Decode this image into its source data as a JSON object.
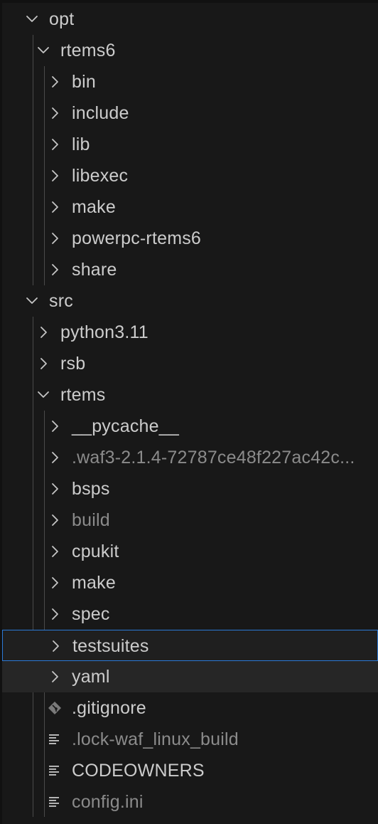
{
  "explorer": {
    "items": [
      {
        "label": "opt",
        "type": "folder",
        "expanded": true,
        "depth": 1
      },
      {
        "label": "rtems6",
        "type": "folder",
        "expanded": true,
        "depth": 2
      },
      {
        "label": "bin",
        "type": "folder",
        "expanded": false,
        "depth": 3
      },
      {
        "label": "include",
        "type": "folder",
        "expanded": false,
        "depth": 3
      },
      {
        "label": "lib",
        "type": "folder",
        "expanded": false,
        "depth": 3
      },
      {
        "label": "libexec",
        "type": "folder",
        "expanded": false,
        "depth": 3
      },
      {
        "label": "make",
        "type": "folder",
        "expanded": false,
        "depth": 3
      },
      {
        "label": "powerpc-rtems6",
        "type": "folder",
        "expanded": false,
        "depth": 3
      },
      {
        "label": "share",
        "type": "folder",
        "expanded": false,
        "depth": 3
      },
      {
        "label": "src",
        "type": "folder",
        "expanded": true,
        "depth": 1
      },
      {
        "label": "python3.11",
        "type": "folder",
        "expanded": false,
        "depth": 2
      },
      {
        "label": "rsb",
        "type": "folder",
        "expanded": false,
        "depth": 2
      },
      {
        "label": "rtems",
        "type": "folder",
        "expanded": true,
        "depth": 2
      },
      {
        "label": "__pycache__",
        "type": "folder",
        "expanded": false,
        "depth": 3
      },
      {
        "label": ".waf3-2.1.4-72787ce48f227ac42c...",
        "type": "folder",
        "expanded": false,
        "depth": 3,
        "dimmed": true
      },
      {
        "label": "bsps",
        "type": "folder",
        "expanded": false,
        "depth": 3
      },
      {
        "label": "build",
        "type": "folder",
        "expanded": false,
        "depth": 3,
        "dimmed": true
      },
      {
        "label": "cpukit",
        "type": "folder",
        "expanded": false,
        "depth": 3
      },
      {
        "label": "make",
        "type": "folder",
        "expanded": false,
        "depth": 3
      },
      {
        "label": "spec",
        "type": "folder",
        "expanded": false,
        "depth": 3
      },
      {
        "label": "testsuites",
        "type": "folder",
        "expanded": false,
        "depth": 3,
        "selected": true
      },
      {
        "label": "yaml",
        "type": "folder",
        "expanded": false,
        "depth": 3,
        "hovered": true
      },
      {
        "label": ".gitignore",
        "type": "file",
        "icon": "git-diamond-icon",
        "depth": 3
      },
      {
        "label": ".lock-waf_linux_build",
        "type": "file",
        "icon": "lines-file-icon",
        "depth": 3,
        "dimmed": true
      },
      {
        "label": "CODEOWNERS",
        "type": "file",
        "icon": "lines-file-icon",
        "depth": 3
      },
      {
        "label": "config.ini",
        "type": "file",
        "icon": "lines-file-icon",
        "depth": 3,
        "dimmed": true
      }
    ]
  },
  "colors": {
    "background": "#181818",
    "text": "#cccccc",
    "dimmed_text": "#8b8b8b",
    "selection_border": "#2b79d6",
    "indent_guide": "#4a4a4a"
  }
}
